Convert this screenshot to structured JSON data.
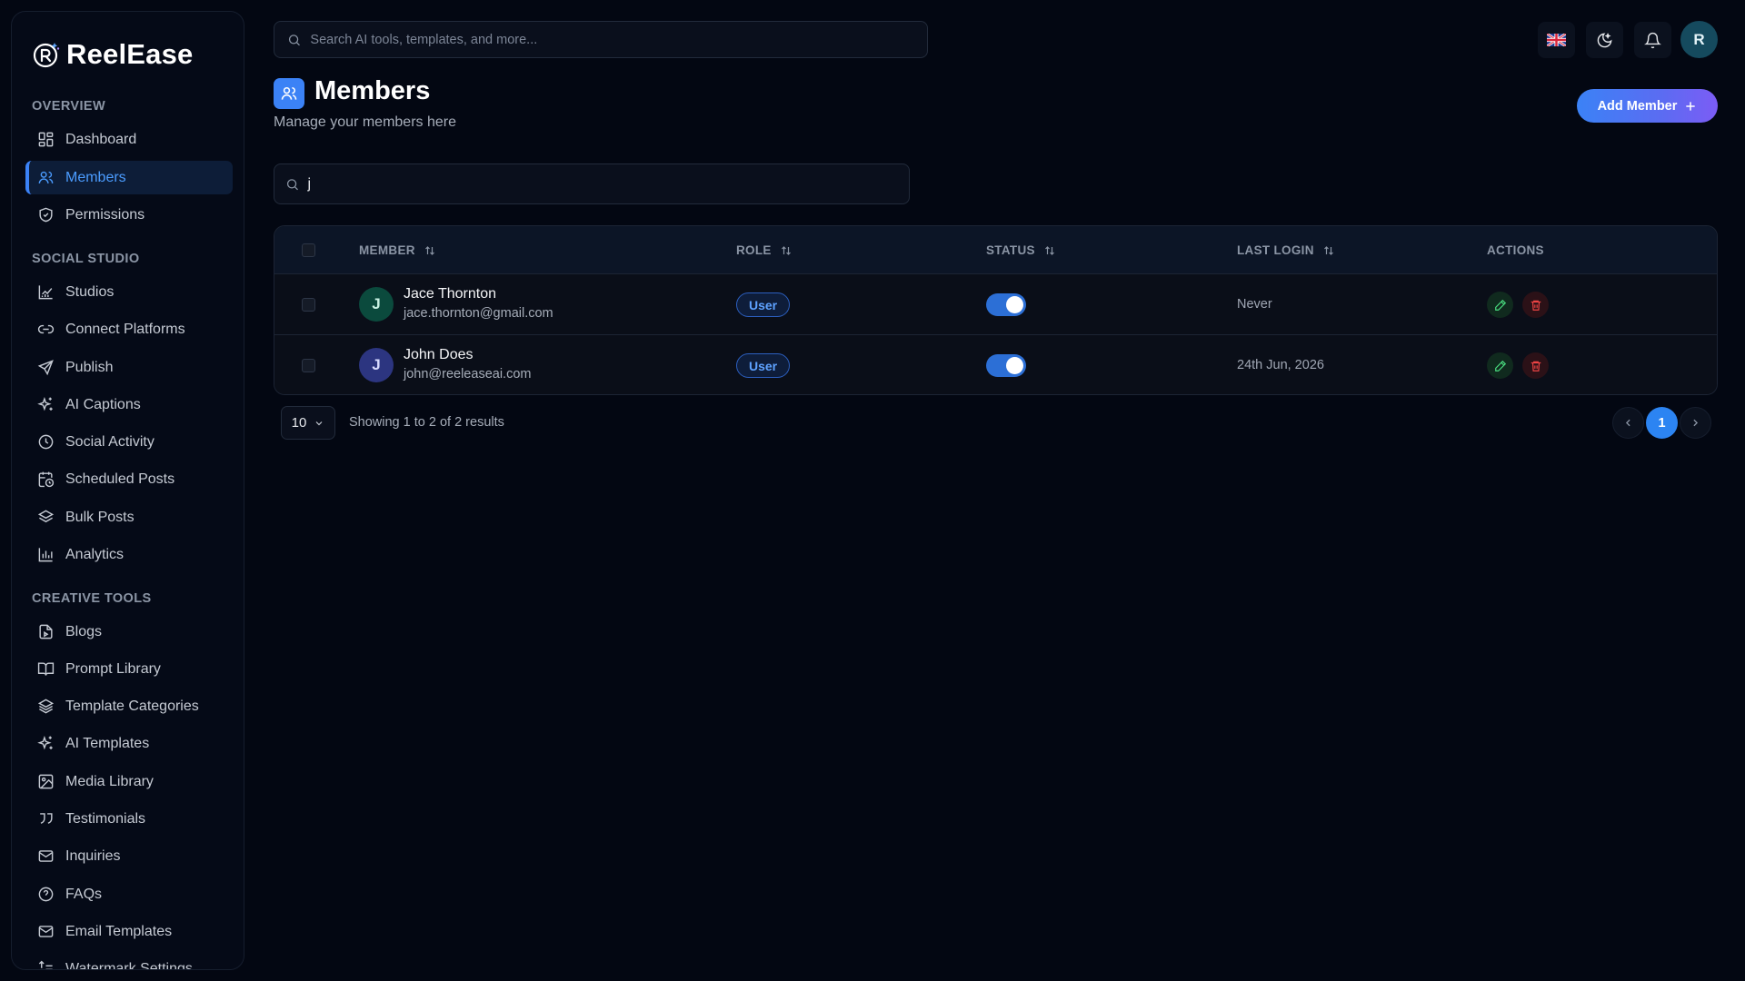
{
  "brand": {
    "name": "ReelEase"
  },
  "sidebar": {
    "sections": [
      {
        "title": "OVERVIEW",
        "items": [
          {
            "label": "Dashboard",
            "icon": "dashboard-icon"
          },
          {
            "label": "Members",
            "icon": "users-icon",
            "active": true
          },
          {
            "label": "Permissions",
            "icon": "shield-icon"
          }
        ]
      },
      {
        "title": "SOCIAL STUDIO",
        "items": [
          {
            "label": "Studios",
            "icon": "chart-line-icon"
          },
          {
            "label": "Connect Platforms",
            "icon": "link-icon"
          },
          {
            "label": "Publish",
            "icon": "send-icon"
          },
          {
            "label": "AI Captions",
            "icon": "sparkles-icon"
          },
          {
            "label": "Social Activity",
            "icon": "clock-icon"
          },
          {
            "label": "Scheduled Posts",
            "icon": "calendar-clock-icon"
          },
          {
            "label": "Bulk Posts",
            "icon": "layers-icon"
          },
          {
            "label": "Analytics",
            "icon": "bar-chart-icon"
          }
        ]
      },
      {
        "title": "CREATIVE TOOLS",
        "items": [
          {
            "label": "Blogs",
            "icon": "file-icon"
          },
          {
            "label": "Prompt Library",
            "icon": "book-icon"
          },
          {
            "label": "Template Categories",
            "icon": "stack-icon"
          },
          {
            "label": "AI Templates",
            "icon": "sparkles-icon"
          },
          {
            "label": "Media Library",
            "icon": "image-icon"
          },
          {
            "label": "Testimonials",
            "icon": "quote-icon"
          },
          {
            "label": "Inquiries",
            "icon": "mail-icon"
          },
          {
            "label": "FAQs",
            "icon": "help-circle-icon"
          },
          {
            "label": "Email Templates",
            "icon": "mail-icon"
          },
          {
            "label": "Watermark Settings",
            "icon": "text-format-icon"
          }
        ]
      }
    ]
  },
  "topbar": {
    "search_placeholder": "Search AI tools, templates, and more...",
    "language_icon": "uk-flag-icon",
    "avatar_initial": "R"
  },
  "page": {
    "title": "Members",
    "subtitle": "Manage your members here",
    "add_button": "Add Member",
    "search_value": "j"
  },
  "table": {
    "columns": [
      "MEMBER",
      "ROLE",
      "STATUS",
      "LAST LOGIN",
      "ACTIONS"
    ],
    "rows": [
      {
        "initial": "J",
        "name": "Jace Thornton",
        "email": "jace.thornton@gmail.com",
        "role": "User",
        "status_active": true,
        "last_login": "Never",
        "avatar_color": "#0b4a3d"
      },
      {
        "initial": "J",
        "name": "John Does",
        "email": "john@reeleaseai.com",
        "role": "User",
        "status_active": true,
        "last_login": "24th Jun, 2026",
        "avatar_color": "#2c3580"
      }
    ]
  },
  "pagination": {
    "page_size": "10",
    "showing": "Showing 1 to 2 of 2 results",
    "current_page": "1"
  },
  "colors": {
    "accent": "#3b82f6",
    "background": "#030712",
    "success": "#4ade80",
    "danger": "#ef4444"
  }
}
